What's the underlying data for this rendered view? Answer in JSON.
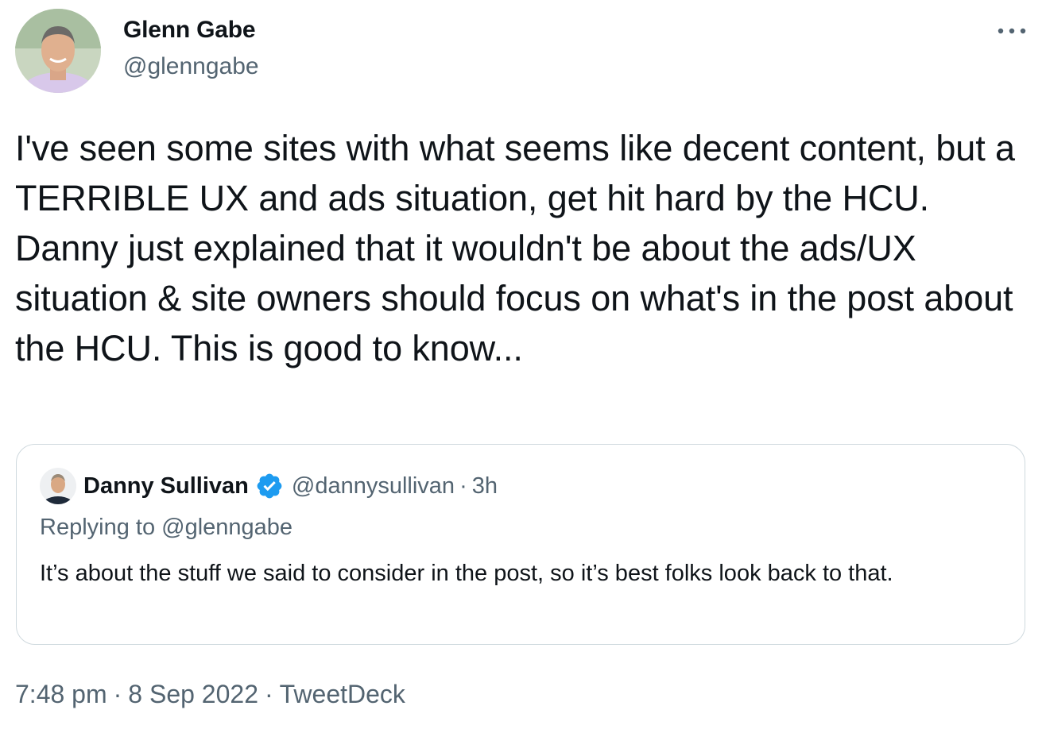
{
  "author": {
    "name": "Glenn Gabe",
    "handle": "@glenngabe"
  },
  "tweet": {
    "text": "I've seen some sites with what seems like decent content, but a TERRIBLE UX and ads situation, get hit hard by the HCU. Danny just explained that it wouldn't be about the ads/UX situation & site owners should focus on what's in the post about the HCU. This is good to know..."
  },
  "quote": {
    "name": "Danny Sullivan",
    "handle": "@dannysullivan",
    "separator": "·",
    "time": "3h",
    "replying_to": "Replying to @glenngabe",
    "text": "It’s about the stuff we said to consider in the post, so it’s best folks look back to that."
  },
  "meta": {
    "time": "7:48 pm",
    "date": "8 Sep 2022",
    "separator": "·",
    "source": "TweetDeck"
  },
  "icons": {
    "more": "more-icon",
    "verified": "verified-badge-icon"
  },
  "colors": {
    "text_primary": "#0f1419",
    "text_secondary": "#536471",
    "verified": "#1d9bf0",
    "border": "#cfd9de"
  }
}
